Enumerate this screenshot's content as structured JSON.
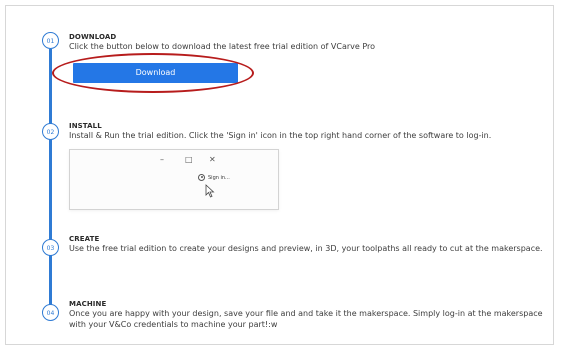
{
  "steps": [
    {
      "number": "01",
      "heading": "DOWNLOAD",
      "description": "Click the button below to download the latest free trial edition of VCarve Pro",
      "button_label": "Download"
    },
    {
      "number": "02",
      "heading": "INSTALL",
      "description": "Install & Run the trial edition. Click the 'Sign in' icon in the top right hand corner of the software to log-in.",
      "screenshot": {
        "minimize": "–",
        "maximize": "□",
        "close": "✕",
        "signin_label": "Sign in..."
      }
    },
    {
      "number": "03",
      "heading": "CREATE",
      "description": "Use the free trial edition to create your designs and preview, in 3D, your toolpaths all ready to cut at the makerspace."
    },
    {
      "number": "04",
      "heading": "MACHINE",
      "description": "Once you are happy with your design, save your file and and take it the makerspace. Simply log-in at the makerspace with your V&Co credentials to machine your part!:w"
    }
  ],
  "colors": {
    "accent": "#2f7bd4",
    "button": "#2477e6",
    "highlight": "#b71c1c"
  },
  "icons": {
    "signin": "user-circle-icon",
    "cursor": "mouse-pointer-icon"
  }
}
